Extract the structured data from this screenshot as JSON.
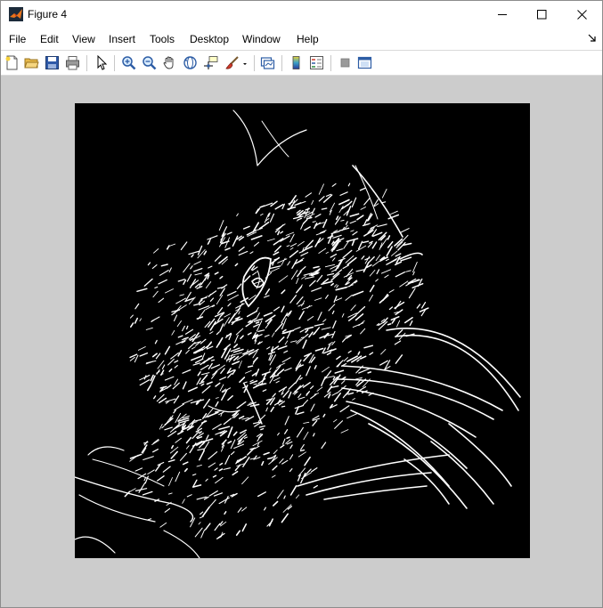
{
  "window": {
    "title": "Figure 4"
  },
  "menu": {
    "items": [
      "File",
      "Edit",
      "View",
      "Insert",
      "Tools",
      "Desktop",
      "Window",
      "Help"
    ]
  },
  "toolbar": {
    "buttons": [
      "new-figure-icon",
      "open-file-icon",
      "save-icon",
      "print-icon",
      "edit-plot-arrow-icon",
      "zoom-in-icon",
      "zoom-out-icon",
      "pan-hand-icon",
      "rotate-3d-icon",
      "data-cursor-icon",
      "brush-icon",
      "link-plot-icon",
      "colorbar-icon",
      "legend-icon",
      "hide-plot-tools-icon",
      "show-plot-tools-icon"
    ]
  },
  "colors": {
    "figure_background": "#cccccc",
    "axes_background": "#000000",
    "edges": "#ffffff"
  }
}
